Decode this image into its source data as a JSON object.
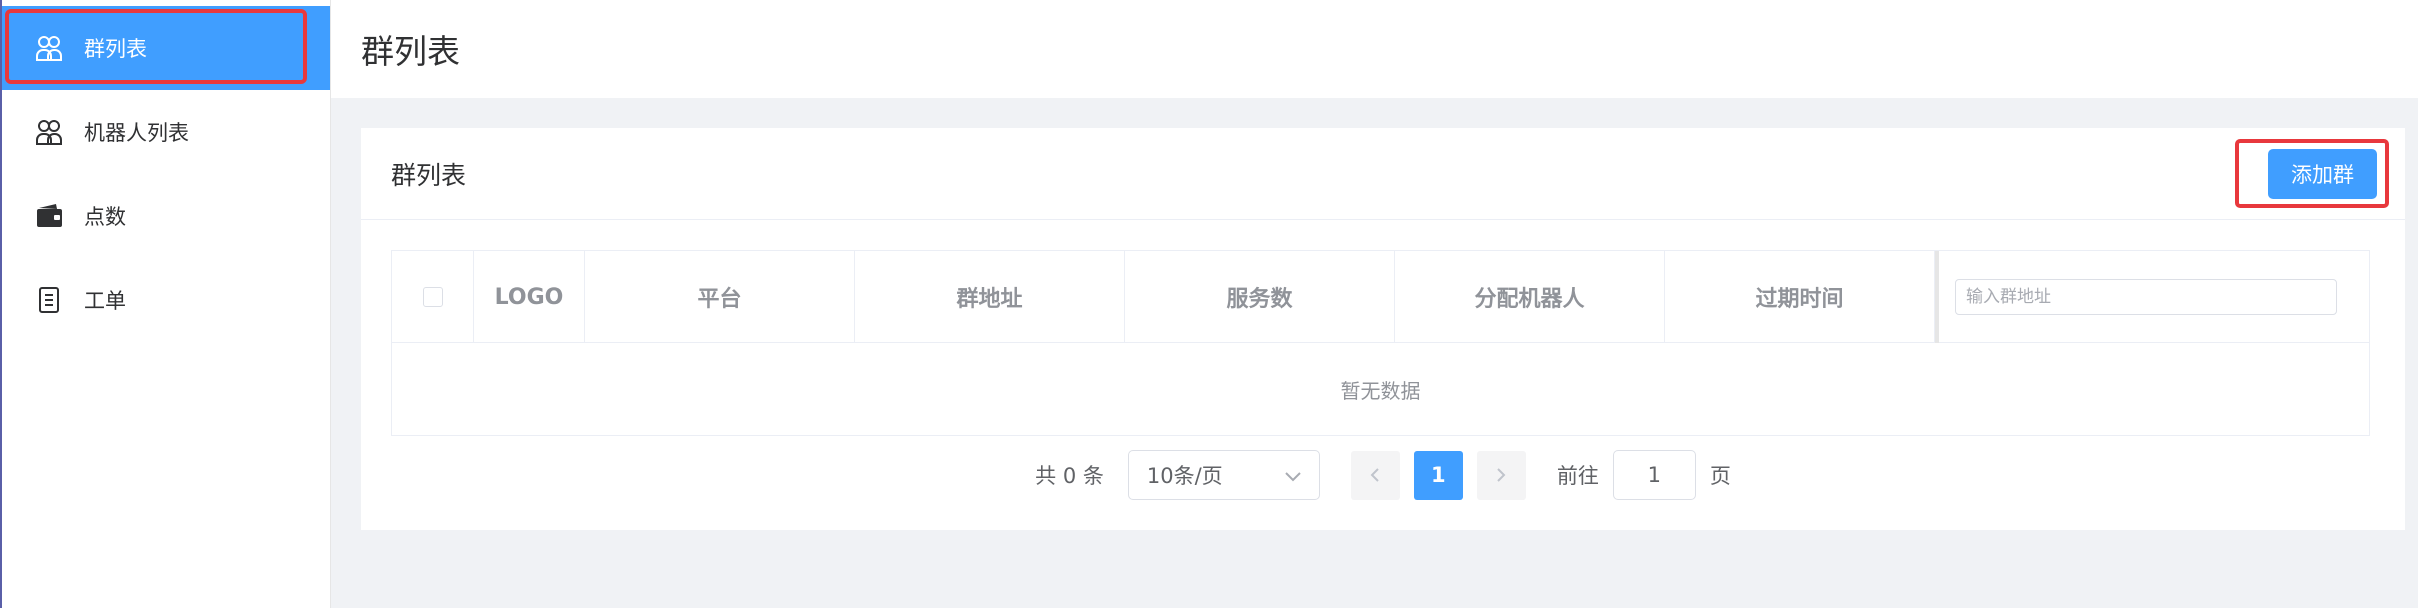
{
  "sidebar": {
    "items": [
      {
        "label": "群列表",
        "icon": "group-icon",
        "active": true
      },
      {
        "label": "机器人列表",
        "icon": "robot-group-icon",
        "active": false
      },
      {
        "label": "点数",
        "icon": "wallet-icon",
        "active": false
      },
      {
        "label": "工单",
        "icon": "ticket-icon",
        "active": false
      }
    ]
  },
  "header": {
    "title": "群列表"
  },
  "card": {
    "title": "群列表",
    "add_button": "添加群"
  },
  "table": {
    "columns": [
      "LOGO",
      "平台",
      "群地址",
      "服务数",
      "分配机器人",
      "过期时间"
    ],
    "search_placeholder": "输入群地址",
    "empty_text": "暂无数据"
  },
  "pagination": {
    "total": "共 0 条",
    "page_size": "10条/页",
    "current_page": "1",
    "goto_label": "前往",
    "goto_value": "1",
    "page_unit": "页"
  },
  "colors": {
    "accent": "#409eff",
    "highlight": "#e8383d"
  }
}
